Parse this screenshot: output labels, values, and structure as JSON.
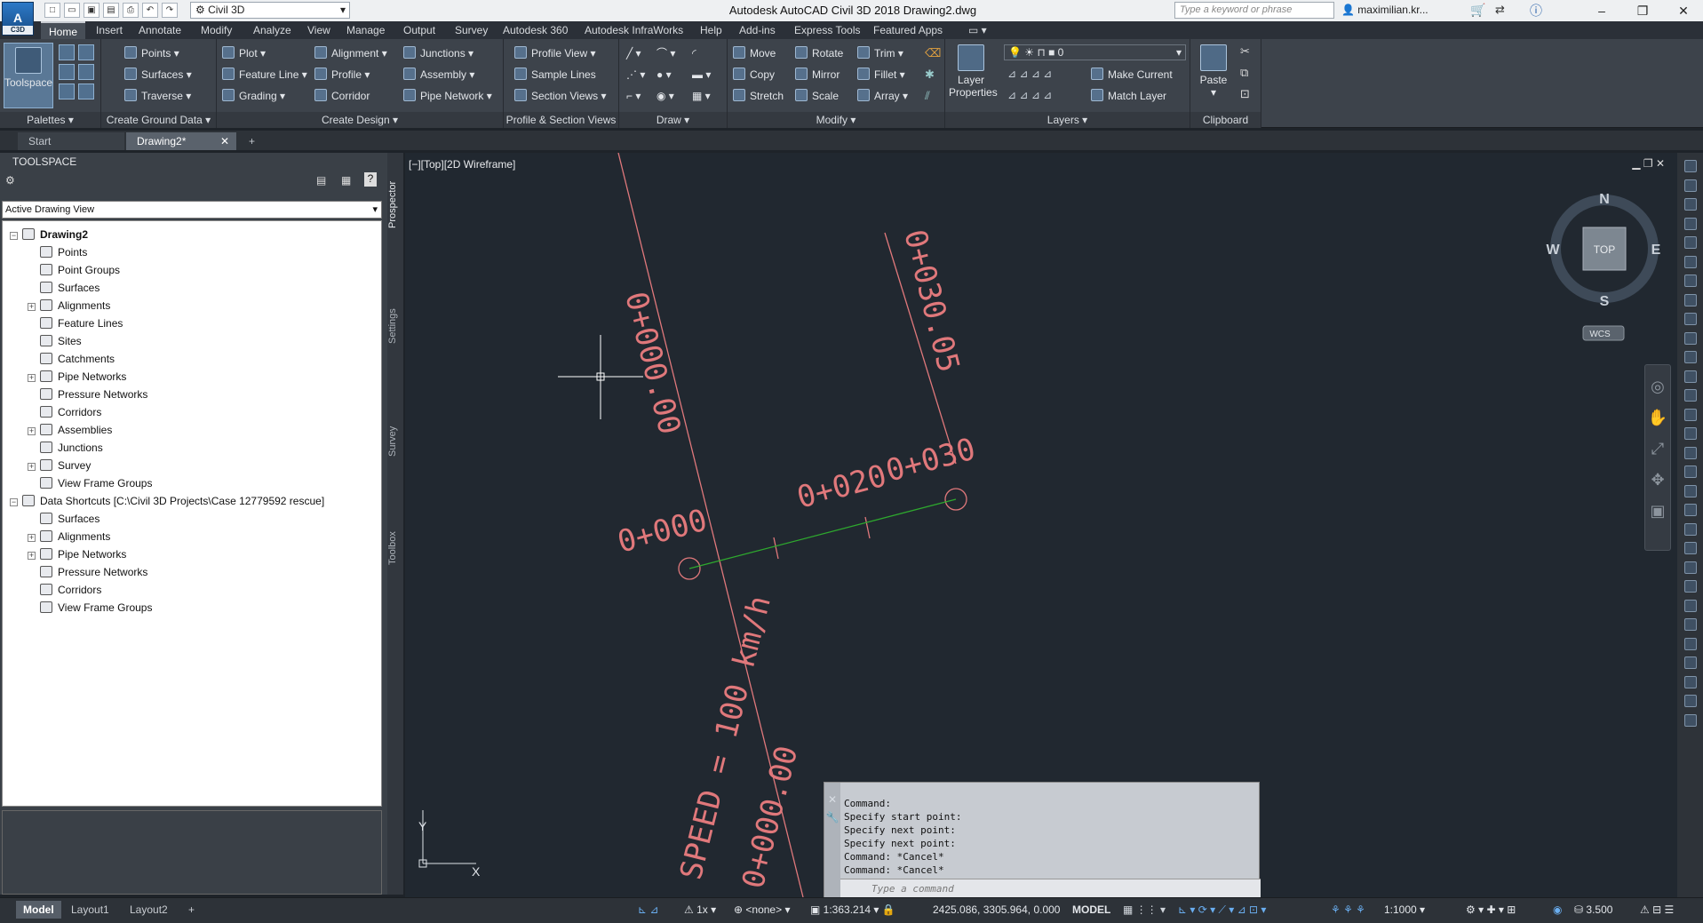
{
  "app": {
    "title": "Autodesk AutoCAD Civil 3D 2018   Drawing2.dwg",
    "badge": "C3D",
    "workspace": "Civil 3D",
    "search_placeholder": "Type a keyword or phrase",
    "user": "maximilian.kr..."
  },
  "ribbon_tabs": [
    "Home",
    "Insert",
    "Annotate",
    "Modify",
    "Analyze",
    "View",
    "Manage",
    "Output",
    "Survey",
    "Autodesk 360",
    "Autodesk InfraWorks",
    "Help",
    "Add-ins",
    "Express Tools",
    "Featured Apps"
  ],
  "ribbon": {
    "palettes": {
      "title": "Palettes",
      "toolspace": "Toolspace"
    },
    "ground": {
      "title": "Create Ground Data",
      "items": [
        "Points",
        "Surfaces",
        "Traverse"
      ]
    },
    "design": {
      "title": "Create Design",
      "items": [
        "Plot",
        "Feature Line",
        "Grading",
        "Alignment",
        "Profile",
        "Corridor",
        "Junctions",
        "Assembly",
        "Pipe Network"
      ]
    },
    "profile": {
      "title": "Profile & Section Views",
      "items": [
        "Profile View",
        "Sample Lines",
        "Section Views"
      ]
    },
    "draw": {
      "title": "Draw"
    },
    "modify": {
      "title": "Modify",
      "items": [
        "Move",
        "Copy",
        "Stretch",
        "Rotate",
        "Mirror",
        "Scale",
        "Trim",
        "Fillet",
        "Array"
      ]
    },
    "layers": {
      "title": "Layers",
      "layer_properties": "Layer Properties",
      "current_layer": "0",
      "make_current": "Make Current",
      "match_layer": "Match Layer"
    },
    "clipboard": {
      "title": "Clipboard",
      "paste": "Paste"
    }
  },
  "doc_tabs": [
    "Start",
    "Drawing2*"
  ],
  "toolspace": {
    "title": "TOOLSPACE",
    "view": "Active Drawing View",
    "tree": [
      {
        "label": "Drawing2",
        "level": 0,
        "exp": "-",
        "bold": true
      },
      {
        "label": "Points",
        "level": 1,
        "exp": ""
      },
      {
        "label": "Point Groups",
        "level": 1,
        "exp": ""
      },
      {
        "label": "Surfaces",
        "level": 1,
        "exp": ""
      },
      {
        "label": "Alignments",
        "level": 1,
        "exp": "+"
      },
      {
        "label": "Feature Lines",
        "level": 1,
        "exp": ""
      },
      {
        "label": "Sites",
        "level": 1,
        "exp": ""
      },
      {
        "label": "Catchments",
        "level": 1,
        "exp": ""
      },
      {
        "label": "Pipe Networks",
        "level": 1,
        "exp": "+"
      },
      {
        "label": "Pressure Networks",
        "level": 1,
        "exp": ""
      },
      {
        "label": "Corridors",
        "level": 1,
        "exp": ""
      },
      {
        "label": "Assemblies",
        "level": 1,
        "exp": "+"
      },
      {
        "label": "Junctions",
        "level": 1,
        "exp": ""
      },
      {
        "label": "Survey",
        "level": 1,
        "exp": "+"
      },
      {
        "label": "View Frame Groups",
        "level": 1,
        "exp": ""
      },
      {
        "label": "Data Shortcuts [C:\\Civil 3D Projects\\Case 12779592 rescue]",
        "level": 0,
        "exp": "-"
      },
      {
        "label": "Surfaces",
        "level": 1,
        "exp": ""
      },
      {
        "label": "Alignments",
        "level": 1,
        "exp": "+"
      },
      {
        "label": "Pipe Networks",
        "level": 1,
        "exp": "+"
      },
      {
        "label": "Pressure Networks",
        "level": 1,
        "exp": ""
      },
      {
        "label": "Corridors",
        "level": 1,
        "exp": ""
      },
      {
        "label": "View Frame Groups",
        "level": 1,
        "exp": ""
      }
    ],
    "side_tabs": [
      "Prospector",
      "Settings",
      "Survey",
      "Toolbox"
    ]
  },
  "viewport": {
    "label": "[−][Top][2D Wireframe]",
    "compass": {
      "n": "N",
      "s": "S",
      "e": "E",
      "w": "W",
      "top": "TOP",
      "wcs": "WCS"
    },
    "ucs": {
      "x": "X",
      "y": "Y"
    },
    "drawing_text": {
      "sta_top1": "0+000.00",
      "sta_top2": "0+030.05",
      "sta_mid1": "0+000",
      "sta_mid2": "0+020",
      "sta_mid3": "0+030",
      "speed": "SPEED = 100 km/h",
      "sta_bottom": "0+000.00"
    },
    "colors": {
      "alignment": "#e0787b",
      "segment": "#2ea82e",
      "background": "#212830"
    }
  },
  "command": {
    "lines": [
      "Command:",
      "Specify start point:",
      "Specify next point:",
      "Specify next point:",
      "Command: *Cancel*",
      "Command: *Cancel*"
    ],
    "placeholder": "Type a command"
  },
  "status": {
    "layout_tabs": [
      "Model",
      "Layout1",
      "Layout2"
    ],
    "scale": "1:363.214",
    "coords": "2425.086, 3305.964, 0.000",
    "model": "MODEL",
    "annoscale": "1:1000",
    "lineweight": "3.500",
    "zoom": "1x",
    "linetype": "<none>"
  }
}
